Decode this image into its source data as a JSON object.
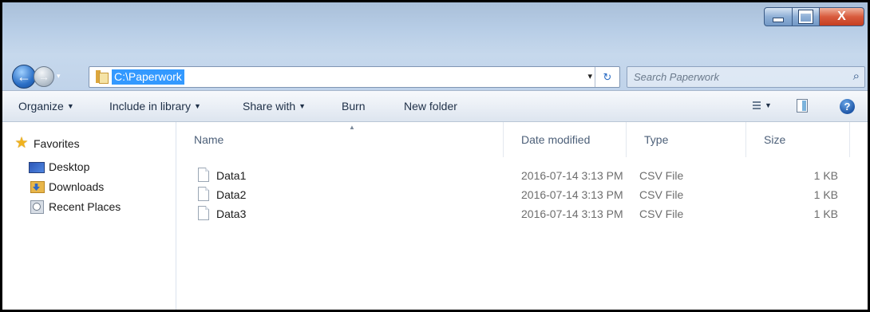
{
  "window": {
    "controls": {
      "minimize_icon": "minimize-icon",
      "maximize_icon": "maximize-icon",
      "close_glyph": "X"
    }
  },
  "navigation": {
    "back_icon": "back-arrow-icon",
    "forward_icon": "forward-arrow-icon",
    "back_glyph": "←",
    "forward_glyph": "→",
    "recent_glyph": "▾"
  },
  "address": {
    "path": "C:\\Paperwork",
    "folder_icon": "folder-icon",
    "dropdown_glyph": "▾",
    "refresh_glyph": "↻"
  },
  "search": {
    "placeholder": "Search Paperwork",
    "icon_glyph": "⌕"
  },
  "toolbar": {
    "organize": "Organize",
    "include_in_library": "Include in library",
    "share_with": "Share with",
    "burn": "Burn",
    "new_folder": "New folder",
    "caret": "▼",
    "help_glyph": "?"
  },
  "sidebar": {
    "favorites": {
      "label": "Favorites",
      "icon": "star-icon",
      "glyph": "★"
    },
    "items": [
      {
        "label": "Desktop",
        "icon": "desktop-icon"
      },
      {
        "label": "Downloads",
        "icon": "downloads-folder-icon"
      },
      {
        "label": "Recent Places",
        "icon": "recent-places-icon"
      }
    ]
  },
  "file_list": {
    "columns": {
      "name": "Name",
      "date_modified": "Date modified",
      "type": "Type",
      "size": "Size"
    },
    "sort_glyph": "▲",
    "rows": [
      {
        "name": "Data1",
        "date_modified": "2016-07-14 3:13 PM",
        "type": "CSV File",
        "size": "1 KB"
      },
      {
        "name": "Data2",
        "date_modified": "2016-07-14 3:13 PM",
        "type": "CSV File",
        "size": "1 KB"
      },
      {
        "name": "Data3",
        "date_modified": "2016-07-14 3:13 PM",
        "type": "CSV File",
        "size": "1 KB"
      }
    ]
  },
  "colors": {
    "selection": "#3399ff",
    "titlebar": "#b7cde6",
    "close_button": "#d85b3d"
  }
}
